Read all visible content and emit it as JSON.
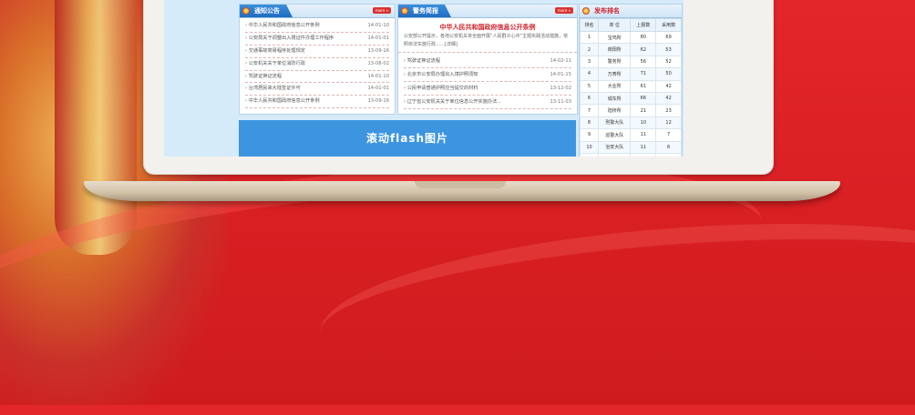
{
  "notice": {
    "title": "通知公告",
    "more": "more »",
    "items": [
      {
        "text": "中华人民共和国政府信息公开条例",
        "date": "14-01-10"
      },
      {
        "text": "公安局关于调整出入境证件办理工作程序",
        "date": "14-01-01"
      },
      {
        "text": "交通事故简易程序处理规定",
        "date": "13-09-16"
      },
      {
        "text": "公安机关关于单位消防行政",
        "date": "13-08-02"
      },
      {
        "text": "驾驶证换证流程",
        "date": "14-01-10"
      },
      {
        "text": "台湾居民来大陆签证许可",
        "date": "14-01-01"
      },
      {
        "text": "中华人民共和国政府信息公开条例",
        "date": "13-09-16"
      }
    ]
  },
  "news": {
    "title": "警务简报",
    "more": "more »",
    "headline": "中华人民共和国政府信息公开条例",
    "summary": "公安部公开提示，各地公安机关将全面开展“人民群众心中”主题实践活动措施，依照依法实施行政……[详细]",
    "items": [
      {
        "text": "驾驶证换证流程",
        "date": "14-02-11"
      },
      {
        "text": "北京市公安局办理出入境护照须知",
        "date": "14-01-15"
      },
      {
        "text": "公民申请普通护照应当提交的材料",
        "date": "13-12-02"
      },
      {
        "text": "辽宁省公安机关关于单位信息公开实施办法…",
        "date": "13-11-03"
      }
    ]
  },
  "flash": {
    "label": "滚动flash图片"
  },
  "rank": {
    "title": "发布排名",
    "columns": [
      "排名",
      "单 位",
      "上报数",
      "采用数"
    ],
    "rows": [
      [
        "1",
        "宝鸡所",
        "80",
        "69"
      ],
      [
        "2",
        "岗阳所",
        "62",
        "53"
      ],
      [
        "3",
        "警务所",
        "56",
        "52"
      ],
      [
        "4",
        "万寿所",
        "71",
        "50"
      ],
      [
        "5",
        "大业所",
        "61",
        "42"
      ],
      [
        "6",
        "城东所",
        "66",
        "42"
      ],
      [
        "7",
        "陆桥所",
        "21",
        "23"
      ],
      [
        "8",
        "刑警大队",
        "10",
        "12"
      ],
      [
        "9",
        "巡警大队",
        "11",
        "7"
      ],
      [
        "10",
        "治安大队",
        "11",
        "6"
      ],
      [
        "11",
        "国保大队",
        "6",
        "4"
      ]
    ]
  }
}
